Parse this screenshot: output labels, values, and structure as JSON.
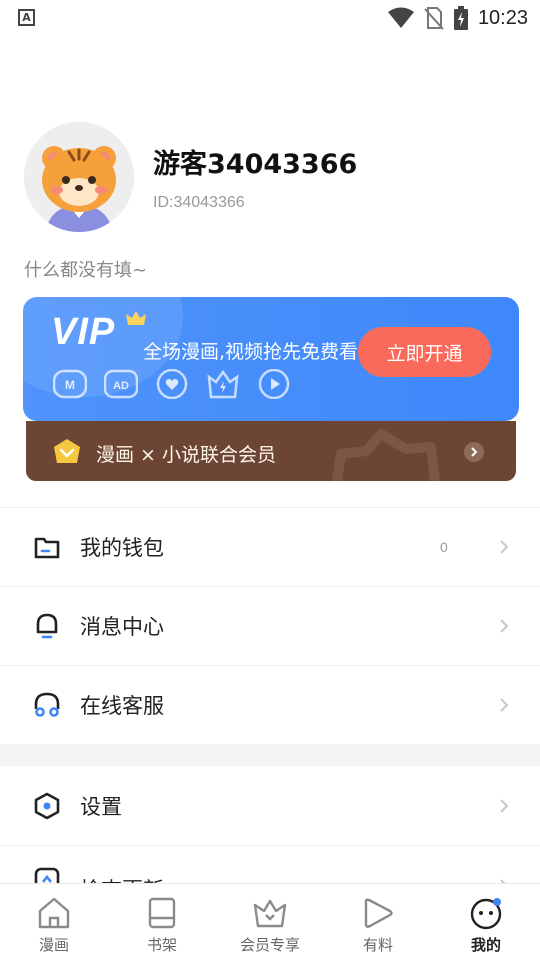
{
  "status_bar": {
    "time": "10:23",
    "notification_letter": "A"
  },
  "profile": {
    "username": "游客34043366",
    "user_id": "ID:34043366",
    "bio": "什么都没有填~"
  },
  "vip_card": {
    "logo": "VIP",
    "tagline": "全场漫画,视频抢先免费看",
    "open_button": "立即开通",
    "benefit_icons": [
      "m-badge-icon",
      "ad-free-icon",
      "heart-icon",
      "lightning-crown-icon",
      "play-icon"
    ]
  },
  "combo_card": {
    "text": "漫画 × 小说联合会员"
  },
  "menu": [
    {
      "label": "我的钱包",
      "icon": "wallet-icon",
      "count": "0"
    },
    {
      "label": "消息中心",
      "icon": "bell-icon"
    },
    {
      "label": "在线客服",
      "icon": "headset-icon"
    }
  ],
  "menu2": [
    {
      "label": "设置",
      "icon": "hexagon-settings-icon"
    },
    {
      "label": "检查更新",
      "icon": "update-icon"
    }
  ],
  "tabs": [
    {
      "label": "漫画",
      "icon": "home-icon"
    },
    {
      "label": "书架",
      "icon": "bookshelf-icon"
    },
    {
      "label": "会员专享",
      "icon": "crown-icon"
    },
    {
      "label": "有料",
      "icon": "play-leaf-icon"
    },
    {
      "label": "我的",
      "icon": "profile-face-icon",
      "active": true
    }
  ],
  "colors": {
    "vip_blue": "#4389fb",
    "vip_button": "#fa6a5a",
    "combo_brown": "#6c4535",
    "accent_blue": "#3d86f6"
  }
}
